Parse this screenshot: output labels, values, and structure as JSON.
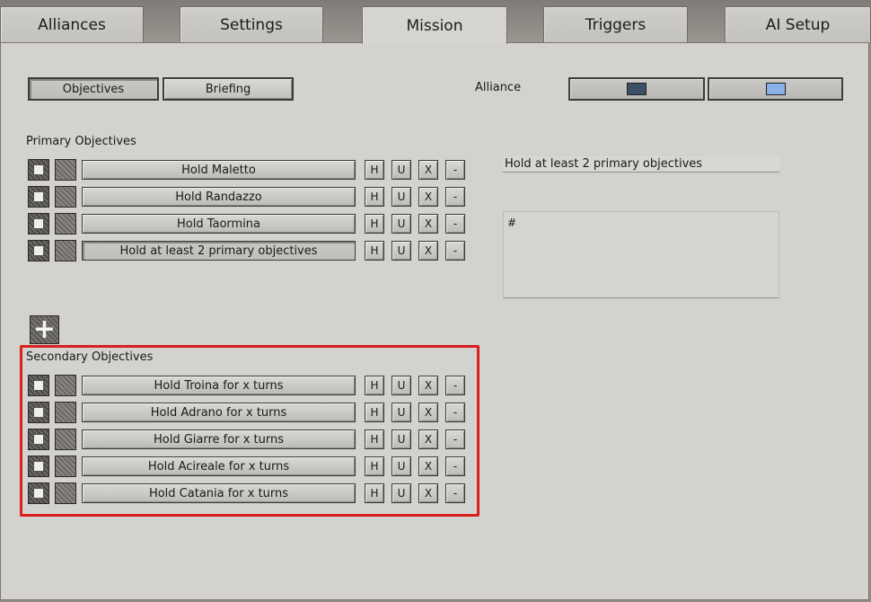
{
  "tabs": [
    {
      "label": "Alliances"
    },
    {
      "label": "Settings"
    },
    {
      "label": "Mission"
    },
    {
      "label": "Triggers"
    },
    {
      "label": "AI Setup"
    }
  ],
  "active_tab": "Mission",
  "subtabs": {
    "objectives": "Objectives",
    "briefing": "Briefing"
  },
  "alliance": {
    "label": "Alliance",
    "colors": [
      "#3d4f66",
      "#8ab0ea"
    ]
  },
  "primary": {
    "title": "Primary Objectives",
    "items": [
      {
        "label": "Hold Maletto"
      },
      {
        "label": "Hold Randazzo"
      },
      {
        "label": "Hold Taormina"
      },
      {
        "label": "Hold at least 2 primary objectives"
      }
    ]
  },
  "secondary": {
    "title": "Secondary Objectives",
    "items": [
      {
        "label": "Hold Troina for x turns"
      },
      {
        "label": "Hold Adrano for x turns"
      },
      {
        "label": "Hold Giarre for x turns"
      },
      {
        "label": "Hold Acireale for x turns"
      },
      {
        "label": "Hold Catania for x turns"
      }
    ]
  },
  "row_buttons": {
    "h": "H",
    "u": "U",
    "x": "X",
    "m": "-"
  },
  "detail": {
    "name_value": "Hold at least 2 primary objectives",
    "description_value": "#"
  },
  "add_icon": "plus-icon",
  "highlight_color": "#d9201e"
}
